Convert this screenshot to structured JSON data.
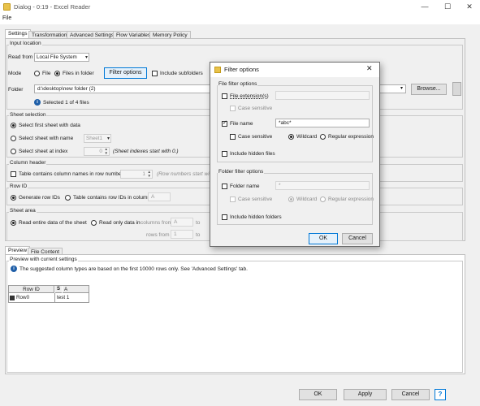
{
  "window": {
    "title": "Dialog - 0:19 - Excel Reader",
    "minimize": "—",
    "maximize": "☐",
    "close": "✕"
  },
  "menu": {
    "file": "File"
  },
  "tabs": [
    {
      "label": "Settings",
      "active": true
    },
    {
      "label": "Transformation",
      "active": false
    },
    {
      "label": "Advanced Settings",
      "active": false
    },
    {
      "label": "Flow Variables",
      "active": false
    },
    {
      "label": "Memory Policy",
      "active": false
    }
  ],
  "input_location": {
    "title": "Input location",
    "read_from_label": "Read from",
    "read_from_value": "Local File System",
    "mode_label": "Mode",
    "mode_file": "File",
    "mode_files_in_folder": "Files in folder",
    "filter_options_button": "Filter options",
    "include_subfolders": "Include subfolders",
    "folder_label": "Folder",
    "folder_value": "d:\\desktop\\new folder (2)",
    "browse_button": "Browse...",
    "selected_info": "Selected 1 of 4 files"
  },
  "sheet_selection": {
    "title": "Sheet selection",
    "first_sheet": "Select first sheet with data",
    "sheet_with_name": "Select sheet with name",
    "sheet_name_value": "Sheet1",
    "sheet_at_index": "Select sheet at index",
    "sheet_index_value": "0",
    "index_note": "(Sheet indexes start with 0.)"
  },
  "column_header": {
    "title": "Column header",
    "contains_names": "Table contains column names in row number",
    "row_number_value": "1",
    "row_note": "(Row numbers start with"
  },
  "row_id": {
    "title": "Row ID",
    "generate": "Generate row IDs",
    "contains_ids": "Table contains row IDs in column",
    "column_value": "A"
  },
  "sheet_area": {
    "title": "Sheet area",
    "read_entire": "Read entire data of the sheet",
    "read_only": "Read only data in",
    "columns_from": "columns from",
    "columns_from_value": "A",
    "to": "to",
    "rows_from": "rows from",
    "rows_from_value": "1"
  },
  "preview": {
    "tabs": [
      {
        "label": "Preview",
        "active": true
      },
      {
        "label": "File Content",
        "active": false
      }
    ],
    "group_title": "Preview with current settings",
    "info": "The suggested column types are based on the first 10000 rows only. See 'Advanced Settings' tab.",
    "table": {
      "rowid_header": "Row ID",
      "type_badge": "S",
      "col_header": "A",
      "rows": [
        {
          "id": "Row0",
          "a": "test 1"
        }
      ]
    }
  },
  "footer": {
    "ok": "OK",
    "apply": "Apply",
    "cancel": "Cancel",
    "help": "?"
  },
  "filter_dialog": {
    "title": "Filter options",
    "close": "✕",
    "file_group_title": "File filter options",
    "file_extension_label": "File extension(s)",
    "file_extension_value": "",
    "case_sensitive": "Case sensitive",
    "file_name_label": "File name",
    "file_name_value": "*abc*",
    "wildcard": "Wildcard",
    "regex": "Regular expression",
    "include_hidden_files": "Include hidden files",
    "folder_group_title": "Folder filter options",
    "folder_name_label": "Folder name",
    "folder_name_value": "*",
    "include_hidden_folders": "Include hidden folders",
    "ok": "OK",
    "cancel": "Cancel"
  },
  "colors": {
    "accent": "#0078d7",
    "dialog_border": "#6a6a6a",
    "info_icon": "#1f5fa8"
  }
}
